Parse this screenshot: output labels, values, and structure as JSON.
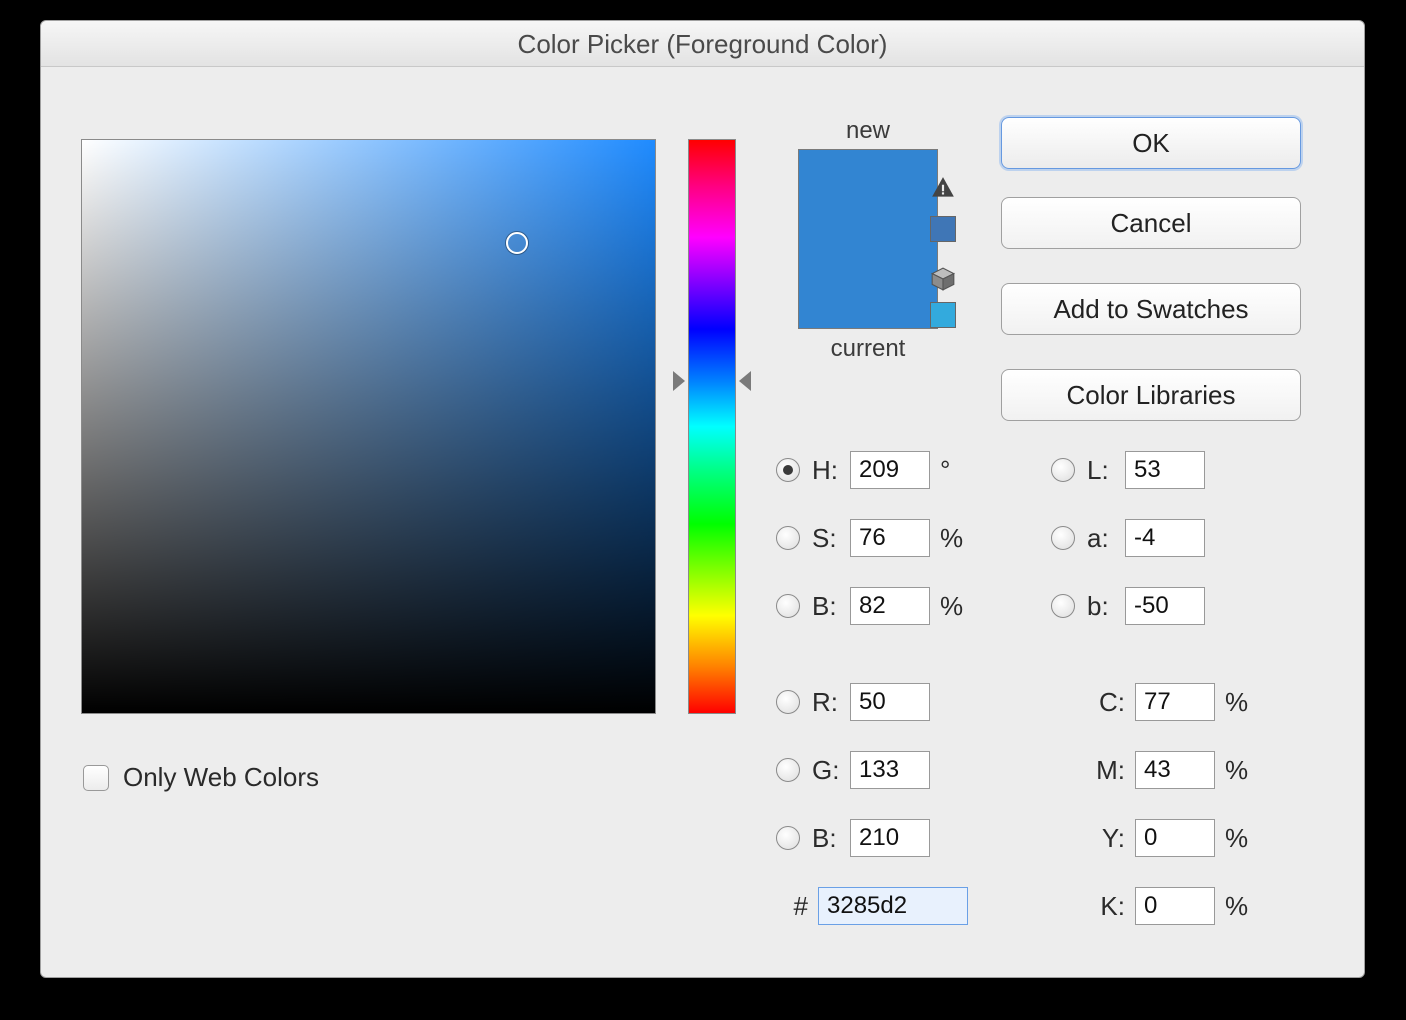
{
  "title": "Color Picker (Foreground Color)",
  "buttons": {
    "ok": "OK",
    "cancel": "Cancel",
    "add_swatches": "Add to Swatches",
    "libraries": "Color Libraries"
  },
  "preview": {
    "new_label": "new",
    "current_label": "current",
    "new_color": "#3285d2",
    "current_color": "#3285d2",
    "gamut_swatch": "#3f76b6",
    "web_swatch": "#33aadd"
  },
  "only_web_colors": {
    "label": "Only Web Colors",
    "checked": false
  },
  "hue_slider_percent": 42,
  "field_cursor": {
    "x_percent": 76,
    "y_percent": 18
  },
  "selected_radio": "H",
  "hsb": {
    "H": "209",
    "H_unit": "°",
    "S": "76",
    "S_unit": "%",
    "B": "82",
    "B_unit": "%"
  },
  "rgb": {
    "R": "50",
    "G": "133",
    "B": "210"
  },
  "lab": {
    "L": "53",
    "a": "-4",
    "b": "-50"
  },
  "cmyk": {
    "C": "77",
    "M": "43",
    "Y": "0",
    "K": "0",
    "unit": "%"
  },
  "hex": {
    "prefix": "#",
    "value": "3285d2"
  },
  "labels": {
    "H": "H:",
    "S": "S:",
    "Bv": "B:",
    "R": "R:",
    "G": "G:",
    "Bc": "B:",
    "L": "L:",
    "a": "a:",
    "b": "b:",
    "C": "C:",
    "M": "M:",
    "Y": "Y:",
    "K": "K:"
  }
}
